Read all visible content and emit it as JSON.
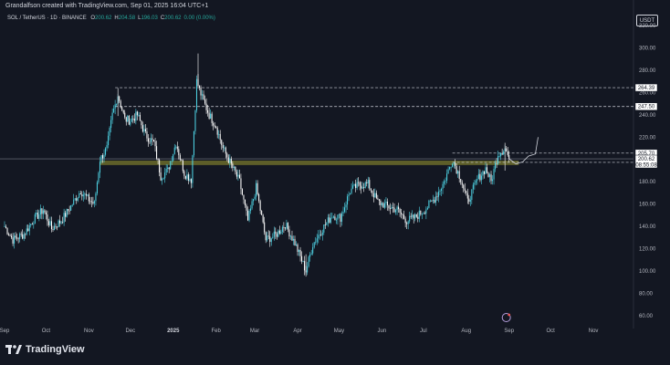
{
  "header": {
    "caption": "Grandalfson created with TradingView.com, Sep 01, 2025 16:04 UTC+1"
  },
  "symbol": {
    "name": "SOL / TetherUS · 1D · BINANCE",
    "ohlc": [
      {
        "k": "O",
        "v": "200.62"
      },
      {
        "k": "H",
        "v": "204.58"
      },
      {
        "k": "L",
        "v": "196.03"
      },
      {
        "k": "C",
        "v": "200.62"
      },
      {
        "k": "",
        "v": "0.00 (0.00%)"
      }
    ]
  },
  "currency": "USDT",
  "footer": {
    "brand": "TradingView"
  },
  "colors": {
    "background": "#131722",
    "up": "#26a69a",
    "down": "#ffffff",
    "candle_body": "#4dd0e1",
    "zone": "#6b6b2a",
    "text": "#b2b5be",
    "level_line": "#d1d4dc",
    "icon": "#b39ddb"
  },
  "chart_data": {
    "type": "candlestick",
    "symbol": "SOL / TetherUS",
    "interval": "1D",
    "exchange": "BINANCE",
    "ylim": [
      55,
      325
    ],
    "y_ticks": [
      60,
      80,
      100,
      120,
      140,
      160,
      180,
      200,
      220,
      240,
      260,
      280,
      300,
      320
    ],
    "x_range": [
      "2024-09-01",
      "2025-11-30"
    ],
    "x_ticks": [
      {
        "label": "Sep",
        "date": "2024-09-01"
      },
      {
        "label": "Oct",
        "date": "2024-10-01"
      },
      {
        "label": "Nov",
        "date": "2024-11-01"
      },
      {
        "label": "Dec",
        "date": "2024-12-01"
      },
      {
        "label": "2025",
        "date": "2025-01-01",
        "bold": true
      },
      {
        "label": "Feb",
        "date": "2025-02-01"
      },
      {
        "label": "Mar",
        "date": "2025-03-01"
      },
      {
        "label": "Apr",
        "date": "2025-04-01"
      },
      {
        "label": "May",
        "date": "2025-05-01"
      },
      {
        "label": "Jun",
        "date": "2025-06-01"
      },
      {
        "label": "Jul",
        "date": "2025-07-01"
      },
      {
        "label": "Aug",
        "date": "2025-08-01"
      },
      {
        "label": "Sep",
        "date": "2025-09-01"
      },
      {
        "label": "Oct",
        "date": "2025-10-01"
      },
      {
        "label": "Nov",
        "date": "2025-11-01"
      }
    ],
    "price_path": [
      [
        "2024-09-01",
        140
      ],
      [
        "2024-09-07",
        128
      ],
      [
        "2024-09-15",
        133
      ],
      [
        "2024-09-22",
        146
      ],
      [
        "2024-09-29",
        155
      ],
      [
        "2024-10-05",
        138
      ],
      [
        "2024-10-12",
        145
      ],
      [
        "2024-10-20",
        160
      ],
      [
        "2024-10-26",
        172
      ],
      [
        "2024-10-31",
        165
      ],
      [
        "2024-11-05",
        160
      ],
      [
        "2024-11-09",
        200
      ],
      [
        "2024-11-14",
        210
      ],
      [
        "2024-11-18",
        240
      ],
      [
        "2024-11-22",
        258
      ],
      [
        "2024-11-27",
        236
      ],
      [
        "2024-12-01",
        235
      ],
      [
        "2024-12-06",
        240
      ],
      [
        "2024-12-12",
        222
      ],
      [
        "2024-12-18",
        215
      ],
      [
        "2024-12-23",
        185
      ],
      [
        "2024-12-28",
        190
      ],
      [
        "2025-01-03",
        215
      ],
      [
        "2025-01-09",
        188
      ],
      [
        "2025-01-14",
        182
      ],
      [
        "2025-01-18",
        270
      ],
      [
        "2025-01-22",
        255
      ],
      [
        "2025-01-27",
        240
      ],
      [
        "2025-02-01",
        230
      ],
      [
        "2025-02-06",
        210
      ],
      [
        "2025-02-12",
        195
      ],
      [
        "2025-02-18",
        180
      ],
      [
        "2025-02-24",
        145
      ],
      [
        "2025-03-02",
        175
      ],
      [
        "2025-03-09",
        128
      ],
      [
        "2025-03-16",
        132
      ],
      [
        "2025-03-23",
        142
      ],
      [
        "2025-03-30",
        125
      ],
      [
        "2025-04-07",
        100
      ],
      [
        "2025-04-12",
        124
      ],
      [
        "2025-04-19",
        138
      ],
      [
        "2025-04-26",
        150
      ],
      [
        "2025-05-02",
        148
      ],
      [
        "2025-05-09",
        172
      ],
      [
        "2025-05-15",
        177
      ],
      [
        "2025-05-22",
        178
      ],
      [
        "2025-05-29",
        162
      ],
      [
        "2025-06-05",
        158
      ],
      [
        "2025-06-12",
        155
      ],
      [
        "2025-06-19",
        145
      ],
      [
        "2025-06-25",
        148
      ],
      [
        "2025-07-02",
        155
      ],
      [
        "2025-07-09",
        165
      ],
      [
        "2025-07-16",
        180
      ],
      [
        "2025-07-22",
        200
      ],
      [
        "2025-07-28",
        183
      ],
      [
        "2025-08-02",
        162
      ],
      [
        "2025-08-09",
        182
      ],
      [
        "2025-08-15",
        192
      ],
      [
        "2025-08-19",
        180
      ],
      [
        "2025-08-24",
        205
      ],
      [
        "2025-08-29",
        210
      ],
      [
        "2025-09-01",
        200.62
      ]
    ],
    "high_wicks": [
      {
        "date": "2024-11-22",
        "price": 264
      },
      {
        "date": "2025-01-19",
        "price": 295
      },
      {
        "date": "2025-08-29",
        "price": 215
      }
    ],
    "low_wicks": [
      {
        "date": "2025-04-07",
        "price": 95
      }
    ],
    "levels": [
      {
        "price": 264.39,
        "label": "264.39",
        "from": "2024-11-20"
      },
      {
        "price": 247.5,
        "label": "247.50",
        "from": "2024-11-20"
      },
      {
        "price": 205.7,
        "label": "205.70",
        "from": "2025-07-22"
      },
      {
        "price": 197.43,
        "label": "197.43",
        "from": "2025-07-22"
      }
    ],
    "last_price": {
      "price": 200.62,
      "label": "200.62",
      "countdown": "08:55:08"
    },
    "zone": {
      "low": 195,
      "high": 199,
      "from": "2024-11-09",
      "to": "2025-09-08"
    },
    "projection": [
      [
        "2025-09-01",
        200.62
      ],
      [
        "2025-09-06",
        196
      ],
      [
        "2025-09-11",
        198
      ],
      [
        "2025-09-15",
        203
      ],
      [
        "2025-09-20",
        205
      ],
      [
        "2025-09-22",
        220
      ]
    ]
  }
}
